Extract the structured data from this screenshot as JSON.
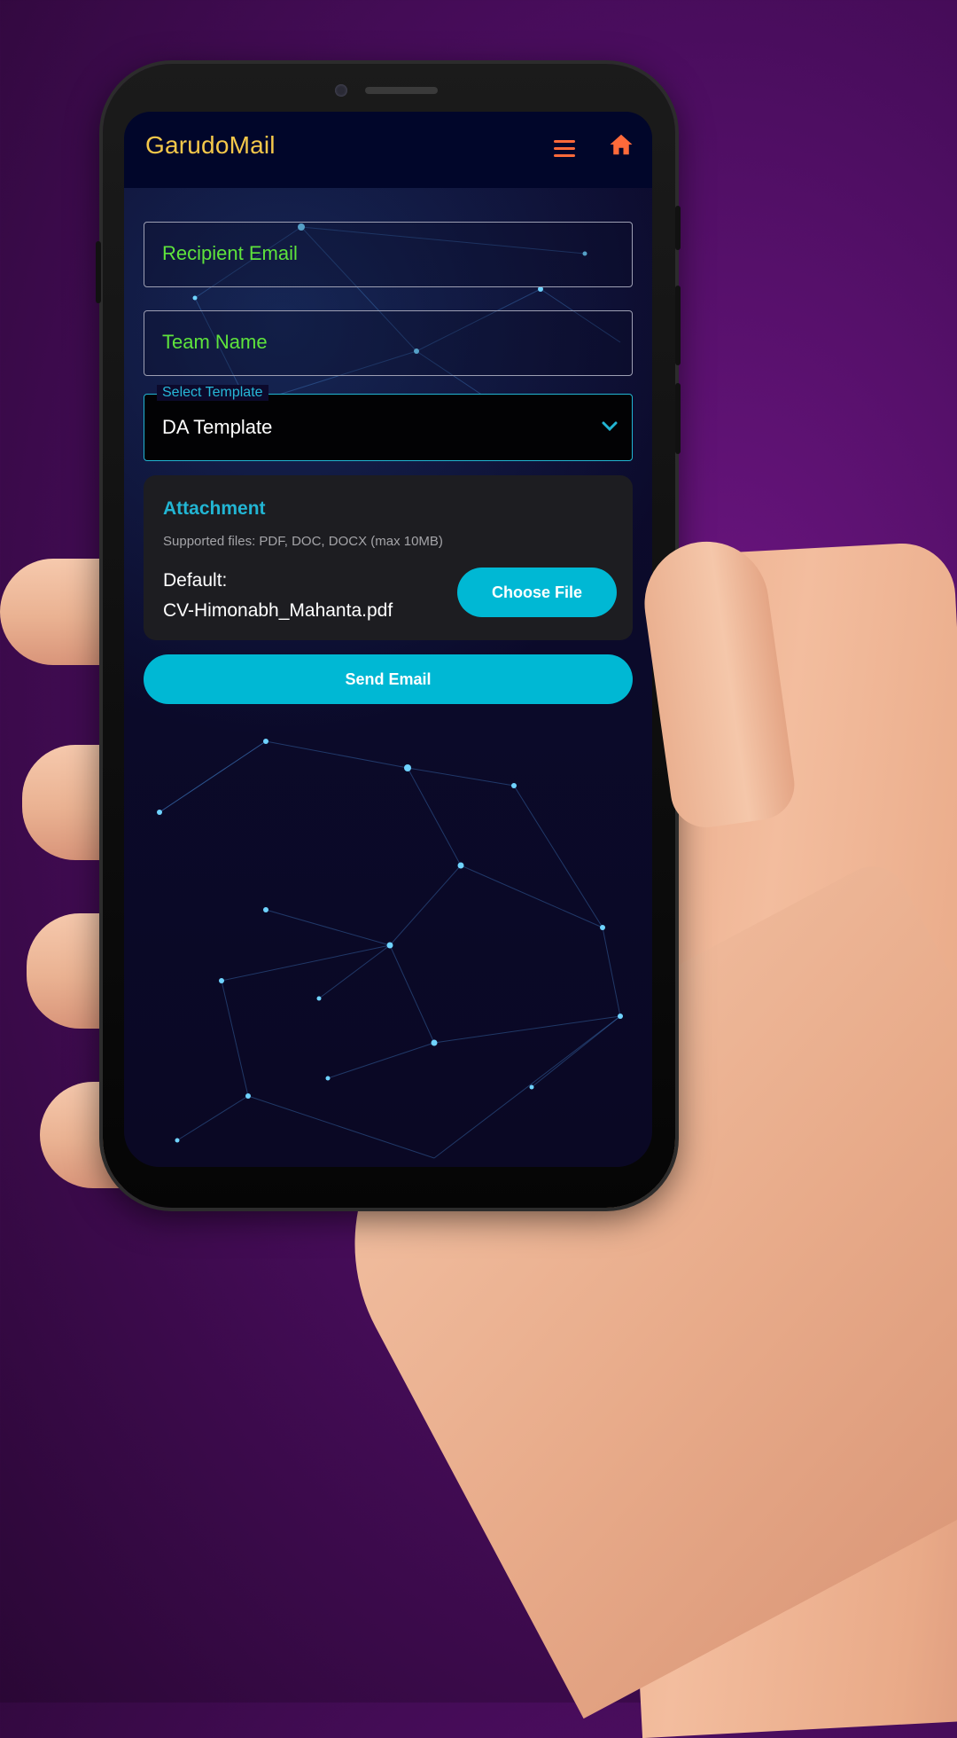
{
  "app": {
    "title": "GarudoMail"
  },
  "appbar": {
    "menu_icon": "hamburger-menu-icon",
    "home_icon": "home-icon",
    "accent_color": "#ff6a3a",
    "title_color": "#f5c84a"
  },
  "form": {
    "recipient_email": {
      "placeholder": "Recipient Email",
      "value": ""
    },
    "team_name": {
      "placeholder": "Team Name",
      "value": ""
    },
    "template": {
      "label": "Select Template",
      "selected": "DA Template"
    }
  },
  "attachment": {
    "title": "Attachment",
    "supported": "Supported files: PDF, DOC, DOCX (max 10MB)",
    "default_label": "Default:",
    "default_file": "CV-Himonabh_Mahanta.pdf",
    "choose_label": "Choose File"
  },
  "actions": {
    "send_label": "Send Email"
  },
  "colors": {
    "accent": "#00b8d4",
    "placeholder": "#5ee33c",
    "background": "#0b0a2a"
  }
}
